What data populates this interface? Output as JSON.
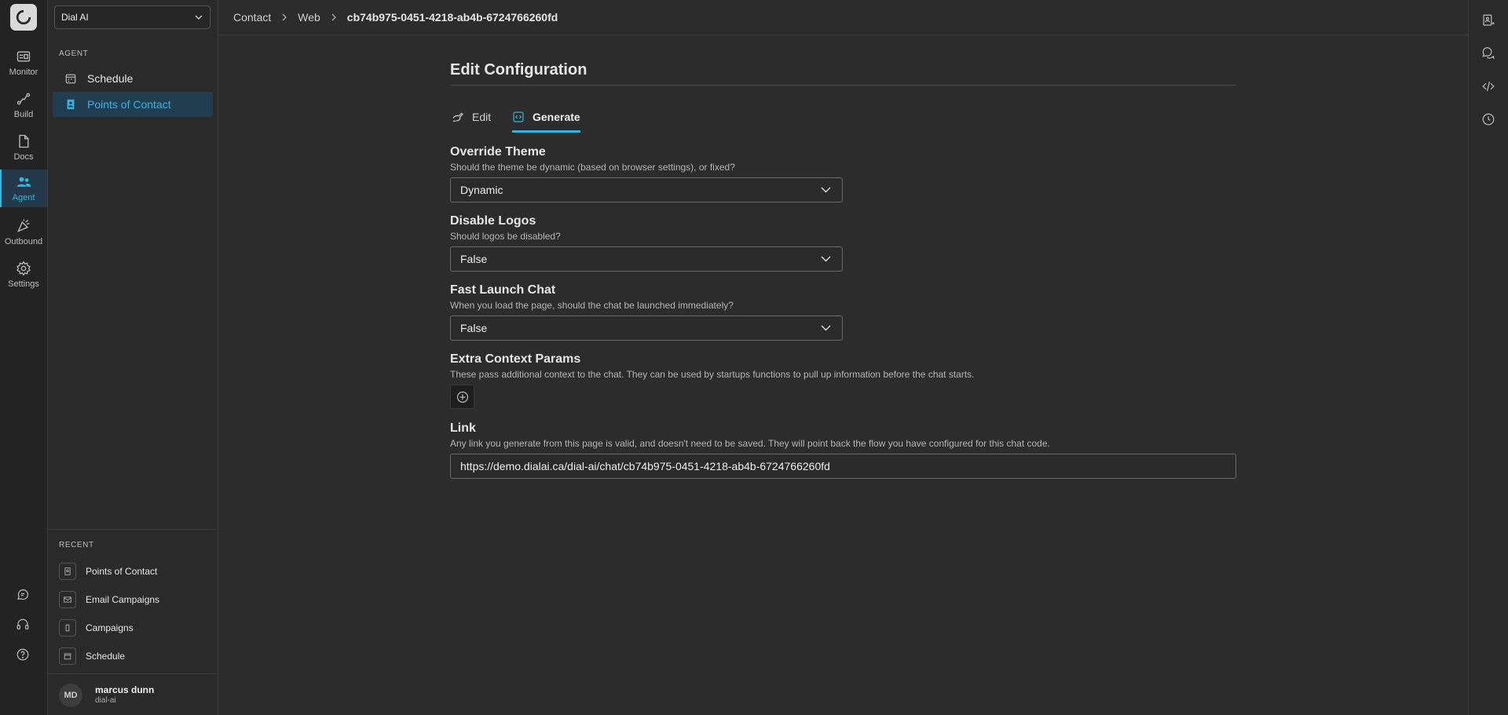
{
  "rail": {
    "items": [
      {
        "label": "Monitor",
        "icon": "monitor-icon"
      },
      {
        "label": "Build",
        "icon": "build-icon"
      },
      {
        "label": "Docs",
        "icon": "docs-icon"
      },
      {
        "label": "Agent",
        "icon": "agent-icon",
        "active": true
      },
      {
        "label": "Outbound",
        "icon": "outbound-icon"
      },
      {
        "label": "Settings",
        "icon": "gear-icon"
      }
    ]
  },
  "sidebar": {
    "org_select": "Dial AI",
    "section_title": "AGENT",
    "items": [
      {
        "label": "Schedule",
        "icon": "calendar-icon"
      },
      {
        "label": "Points of Contact",
        "icon": "contact-icon",
        "active": true
      }
    ],
    "recent_title": "RECENT",
    "recent": [
      {
        "label": "Points of Contact"
      },
      {
        "label": "Email Campaigns"
      },
      {
        "label": "Campaigns"
      },
      {
        "label": "Schedule"
      }
    ],
    "user": {
      "initials": "MD",
      "name": "marcus dunn",
      "org": "dial-ai"
    }
  },
  "breadcrumb": {
    "items": [
      "Contact",
      "Web",
      "cb74b975-0451-4218-ab4b-6724766260fd"
    ]
  },
  "main": {
    "title": "Edit Configuration",
    "tabs": [
      {
        "label": "Edit",
        "icon": "edit-icon"
      },
      {
        "label": "Generate",
        "icon": "code-icon",
        "active": true
      }
    ],
    "fields": {
      "override_theme": {
        "label": "Override Theme",
        "help": "Should the theme be dynamic (based on browser settings), or fixed?",
        "value": "Dynamic"
      },
      "disable_logos": {
        "label": "Disable Logos",
        "help": "Should logos be disabled?",
        "value": "False"
      },
      "fast_launch": {
        "label": "Fast Launch Chat",
        "help": "When you load the page, should the chat be launched immediately?",
        "value": "False"
      },
      "extra_params": {
        "label": "Extra Context Params",
        "help": "These pass additional context to the chat. They can be used by startups functions to pull up information before the chat starts."
      },
      "link": {
        "label": "Link",
        "help": "Any link you generate from this page is valid, and doesn't need to be saved. They will point back the flow you have configured for this chat code.",
        "value": "https://demo.dialai.ca/dial-ai/chat/cb74b975-0451-4218-ab4b-6724766260fd"
      }
    }
  },
  "colors": {
    "accent": "#34b6e4",
    "background": "#2c2c2c",
    "rail_background": "#232323"
  }
}
